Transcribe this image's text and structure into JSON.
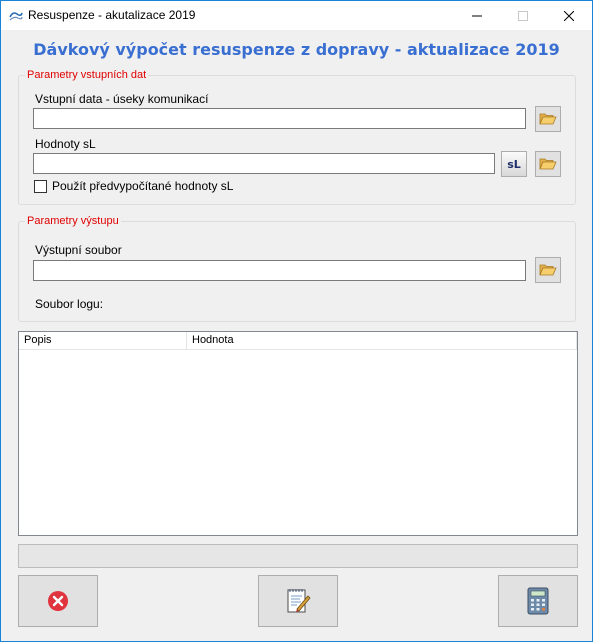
{
  "window": {
    "title": "Resuspenze - akutalizace 2019"
  },
  "header": {
    "title": "Dávkový výpočet resuspenze z dopravy - aktualizace 2019"
  },
  "input_group": {
    "title": "Parametry vstupních dat",
    "segments_label": "Vstupní data - úseky komunikací",
    "segments_value": "",
    "sl_label": "Hodnoty sL",
    "sl_value": "",
    "sl_button": "sL",
    "precomputed_checkbox_label": "Použít předvypočítané hodnoty sL",
    "precomputed_checked": false
  },
  "output_group": {
    "title": "Parametry výstupu",
    "output_file_label": "Výstupní soubor",
    "output_file_value": "",
    "log_label": "Soubor logu:"
  },
  "results_table": {
    "columns": [
      "Popis",
      "Hodnota"
    ],
    "rows": []
  },
  "progress": {
    "fraction": 0
  },
  "icons": {
    "folder": "folder-open-icon",
    "cancel": "cancel-icon",
    "report": "report-edit-icon",
    "calculate": "calculator-icon"
  },
  "colors": {
    "header": "#3a6fd2",
    "group_title": "#e00000",
    "cancel": "#e0353e"
  }
}
